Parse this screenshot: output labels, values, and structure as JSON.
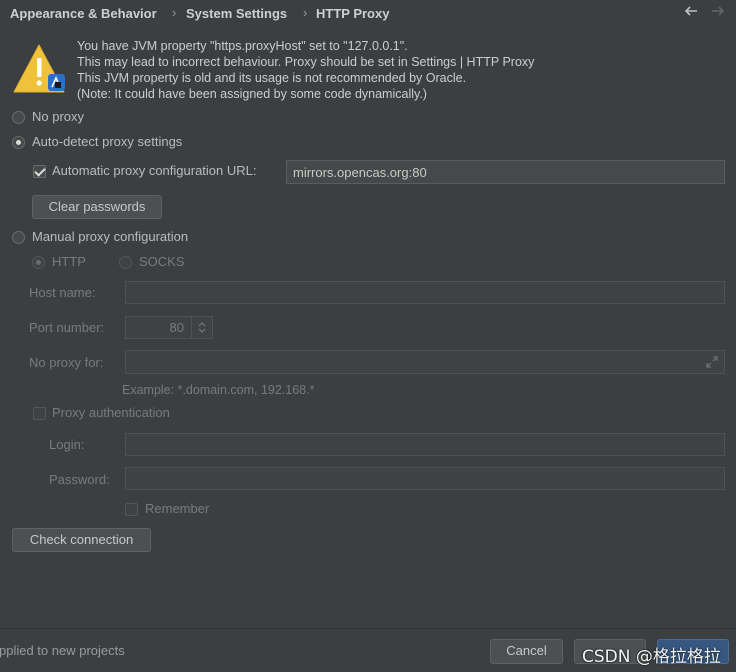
{
  "breadcrumb": {
    "items": [
      "Appearance & Behavior",
      "System Settings",
      "HTTP Proxy"
    ],
    "separator": "›",
    "back_icon": "arrow-left-icon",
    "forward_icon": "arrow-right-icon"
  },
  "warning": {
    "icon": "warning-triangle-icon",
    "lines": [
      "You have JVM property \"https.proxyHost\" set to \"127.0.0.1\".",
      "This may lead to incorrect behaviour. Proxy should be set in Settings | HTTP Proxy",
      "This JVM property is old and its usage is not recommended by Oracle.",
      "(Note: It could have been assigned by some code dynamically.)"
    ]
  },
  "proxy_mode": {
    "no_proxy": "No proxy",
    "auto_detect": "Auto-detect proxy settings",
    "manual": "Manual proxy configuration",
    "selected": "auto_detect"
  },
  "auto": {
    "pac_checkbox_label": "Automatic proxy configuration URL:",
    "pac_checked": true,
    "pac_url": "mirrors.opencas.org:80",
    "clear_passwords": "Clear passwords"
  },
  "manual": {
    "http": "HTTP",
    "socks": "SOCKS",
    "host_label": "Host name:",
    "host_value": "",
    "port_label": "Port number:",
    "port_value": "80",
    "no_proxy_label": "No proxy for:",
    "no_proxy_value": "",
    "example": "Example: *.domain.com, 192.168.*",
    "auth_label": "Proxy authentication",
    "login_label": "Login:",
    "login_value": "",
    "password_label": "Password:",
    "password_value": "",
    "remember_label": "Remember"
  },
  "check_connection": "Check connection",
  "footer": {
    "status": "pplied to new projects",
    "cancel": "Cancel",
    "watermark": "CSDN @格拉格拉"
  },
  "colors": {
    "background": "#3c3f41",
    "accent_button": "#365880",
    "warning_yellow": "#f0c23b"
  }
}
